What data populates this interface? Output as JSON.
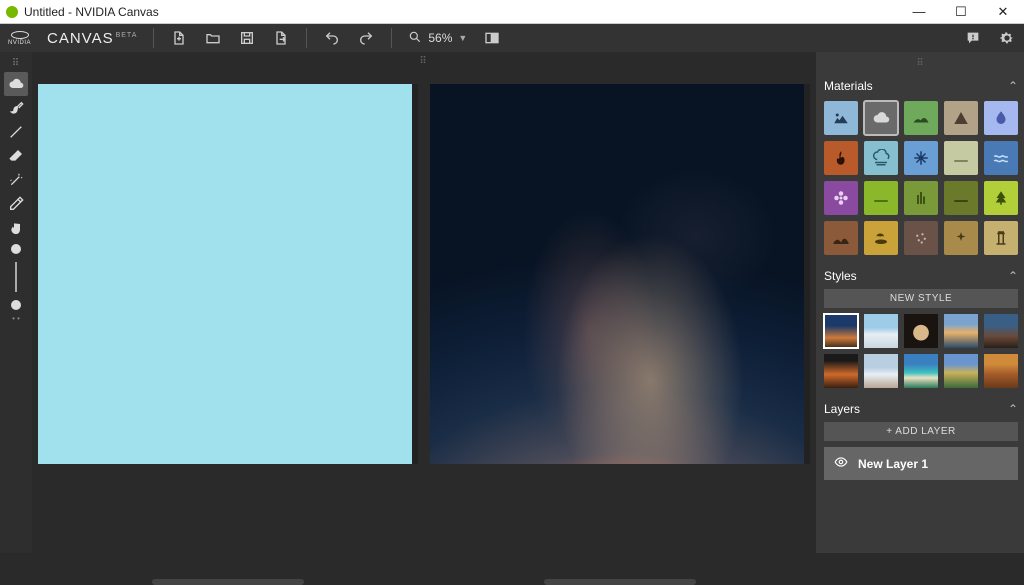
{
  "window": {
    "title": "Untitled - NVIDIA Canvas"
  },
  "brand": {
    "name": "CANVAS",
    "badge": "BETA",
    "logo_sub": "NVIDIA"
  },
  "toolbar": {
    "zoom": "56%"
  },
  "tools": [
    {
      "name": "grip",
      "icon": "grip",
      "selected": false,
      "interact": false
    },
    {
      "name": "material",
      "icon": "cloud",
      "selected": true
    },
    {
      "name": "brush",
      "icon": "brush",
      "selected": false
    },
    {
      "name": "line",
      "icon": "line",
      "selected": false
    },
    {
      "name": "eraser",
      "icon": "eraser",
      "selected": false
    },
    {
      "name": "wand",
      "icon": "wand",
      "selected": false
    },
    {
      "name": "eyedropper",
      "icon": "dropper",
      "selected": false
    },
    {
      "name": "pan",
      "icon": "hand",
      "selected": false
    }
  ],
  "panels": {
    "materials": {
      "title": "Materials",
      "items": [
        {
          "name": "sky",
          "bg": "#8fb7d8",
          "icon": "mountain-sun",
          "fg": "#253b56"
        },
        {
          "name": "cloud",
          "bg": "#6a6a6a",
          "icon": "cloud",
          "fg": "#d8d8d8",
          "selected": true
        },
        {
          "name": "hill",
          "bg": "#6fa95b",
          "icon": "hill",
          "fg": "#2a4a22"
        },
        {
          "name": "mountain",
          "bg": "#b2a288",
          "icon": "peak",
          "fg": "#4a3f30"
        },
        {
          "name": "water-a",
          "bg": "#a6b8f0",
          "icon": "drop",
          "fg": "#4a5aa8"
        },
        {
          "name": "fire",
          "bg": "#b85a2a",
          "icon": "fire",
          "fg": "#2a1208"
        },
        {
          "name": "fog",
          "bg": "#86bfcf",
          "icon": "fog",
          "fg": "#2a5a6a"
        },
        {
          "name": "snow",
          "bg": "#6a9fd6",
          "icon": "snow",
          "fg": "#1a3a66"
        },
        {
          "name": "sand",
          "bg": "#c6caa2",
          "icon": "flat",
          "fg": "#6a6a4a"
        },
        {
          "name": "sea",
          "bg": "#4a7ab6",
          "icon": "waves",
          "fg": "#c8e0f6"
        },
        {
          "name": "flower",
          "bg": "#8a4aa0",
          "icon": "flower",
          "fg": "#e8d0f2"
        },
        {
          "name": "grass",
          "bg": "#8ab82a",
          "icon": "flat",
          "fg": "#3a5a0a"
        },
        {
          "name": "reeds",
          "bg": "#7a9a3a",
          "icon": "reeds",
          "fg": "#2a3a0a"
        },
        {
          "name": "bush",
          "bg": "#6a7a2a",
          "icon": "flat",
          "fg": "#2a3408"
        },
        {
          "name": "tree",
          "bg": "#b2cf3a",
          "icon": "tree",
          "fg": "#3a5008"
        },
        {
          "name": "dirt",
          "bg": "#8a5a3a",
          "icon": "dunes",
          "fg": "#3a2412"
        },
        {
          "name": "island",
          "bg": "#caa23a",
          "icon": "island",
          "fg": "#4a3a08"
        },
        {
          "name": "gravel",
          "bg": "#6a5248",
          "icon": "dots",
          "fg": "#c8b8a8"
        },
        {
          "name": "rock",
          "bg": "#a88a4a",
          "icon": "sparkle",
          "fg": "#4a3a1a"
        },
        {
          "name": "ruin",
          "bg": "#c6b070",
          "icon": "pillar",
          "fg": "#4a3a1a"
        }
      ]
    },
    "styles": {
      "title": "Styles",
      "new_label": "NEW STYLE",
      "items": [
        {
          "name": "style-1",
          "cls": "t-sunset1",
          "selected": true
        },
        {
          "name": "style-2",
          "cls": "t-snow"
        },
        {
          "name": "style-3",
          "cls": "t-arch"
        },
        {
          "name": "style-4",
          "cls": "t-lake"
        },
        {
          "name": "style-5",
          "cls": "t-rock"
        },
        {
          "name": "style-6",
          "cls": "t-sunset2"
        },
        {
          "name": "style-7",
          "cls": "t-winter"
        },
        {
          "name": "style-8",
          "cls": "t-trop"
        },
        {
          "name": "style-9",
          "cls": "t-valley"
        },
        {
          "name": "style-10",
          "cls": "t-desert"
        }
      ]
    },
    "layers": {
      "title": "Layers",
      "add_label": "+ ADD LAYER",
      "items": [
        {
          "name": "New Layer 1",
          "visible": true
        }
      ]
    }
  }
}
